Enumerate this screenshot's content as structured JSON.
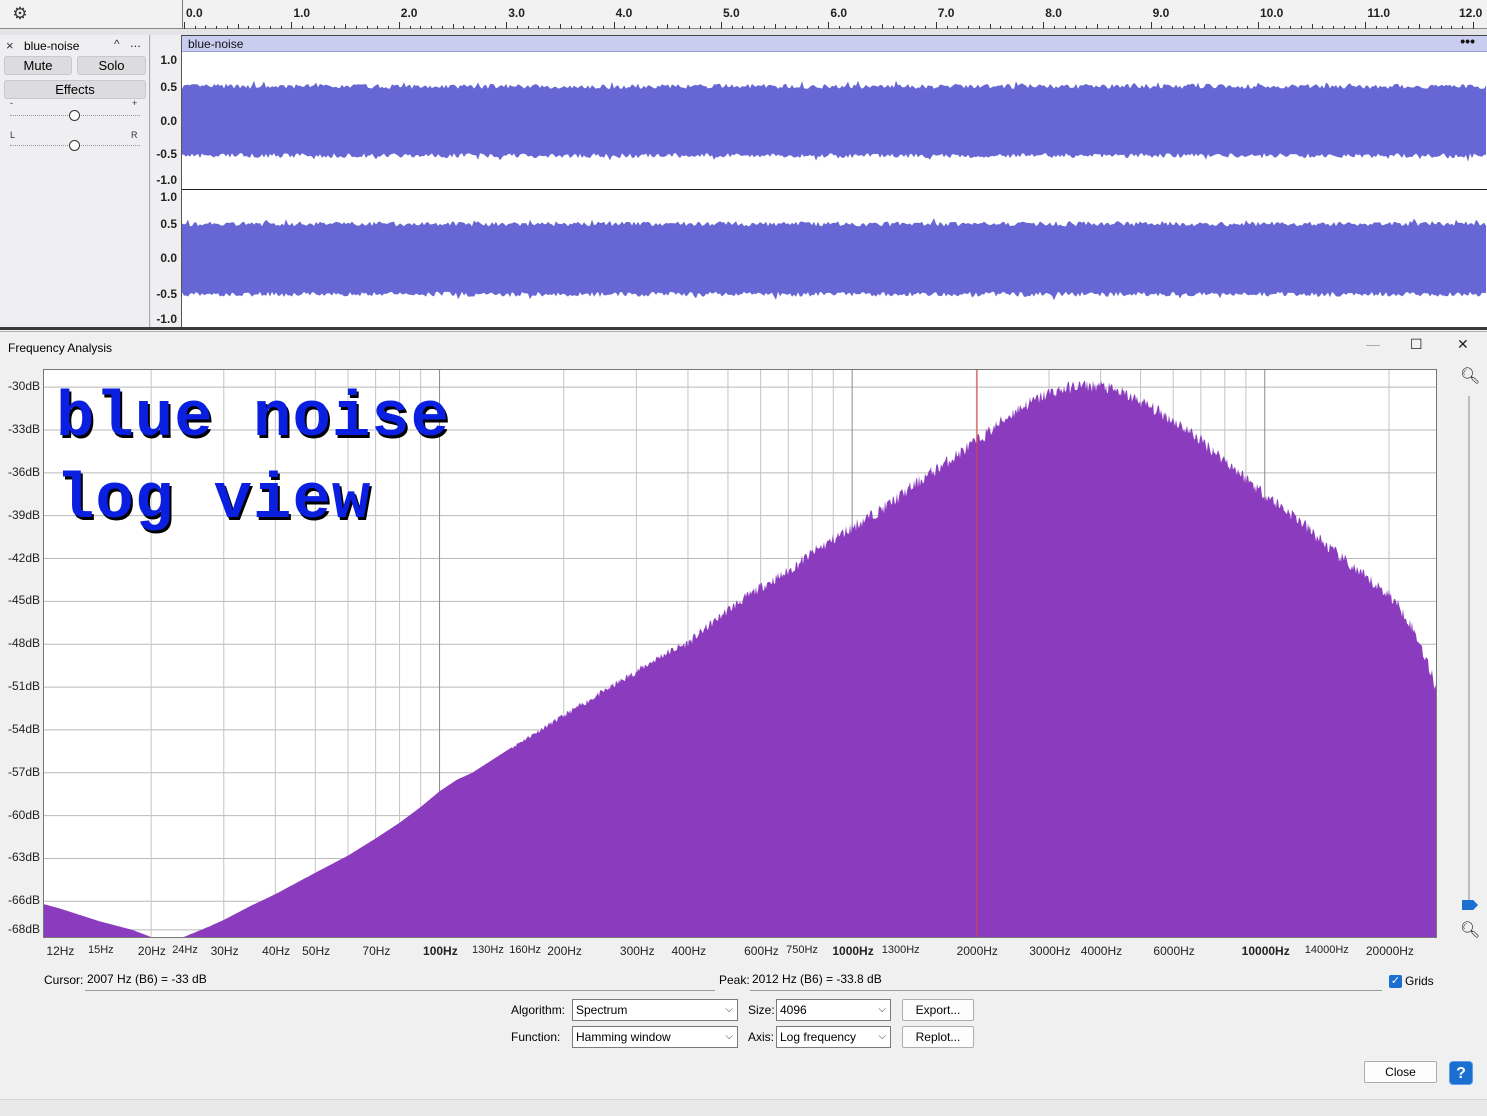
{
  "ruler": {
    "labels": [
      "0.0",
      "1.0",
      "2.0",
      "3.0",
      "4.0",
      "5.0",
      "6.0",
      "7.0",
      "8.0",
      "9.0",
      "10.0",
      "11.0",
      "12.0"
    ]
  },
  "track": {
    "name": "blue-noise",
    "mute_label": "Mute",
    "solo_label": "Solo",
    "effects_label": "Effects",
    "gain_min": "-",
    "gain_max": "+",
    "pan_left": "L",
    "pan_right": "R",
    "collapse_glyph": "^",
    "menu_glyph": "...",
    "close_glyph": "×",
    "gain_level": 0.5,
    "pan_level": 0.5
  },
  "clip": {
    "name": "blue-noise",
    "menu_glyph": "•••",
    "wave_color": "#6666d4"
  },
  "amp_scale": {
    "labels": [
      "1.0",
      "0.5",
      "0.0",
      "-0.5",
      "-1.0"
    ]
  },
  "dialog": {
    "title": "Frequency Analysis",
    "minimize": "—",
    "maximize": "☐",
    "close": "✕",
    "overlay_line1": "blue noise",
    "overlay_line2": "log view",
    "cursor_label": "Cursor:",
    "cursor_value": "2007 Hz (B6) = -33 dB",
    "peak_label": "Peak:",
    "peak_value": "2012 Hz (B6) = -33.8 dB",
    "grids_label": "Grids",
    "grids_checked": true,
    "algorithm_label": "Algorithm:",
    "algorithm_value": "Spectrum",
    "size_label": "Size:",
    "size_value": "4096",
    "export_label": "Export...",
    "function_label": "Function:",
    "function_value": "Hamming window",
    "axis_label": "Axis:",
    "axis_value": "Log frequency",
    "replot_label": "Replot...",
    "close_label": "Close",
    "help_label": "?",
    "spectrum_color": "#8a3bbe",
    "cursor_line_color": "#e04040"
  },
  "chart_data": {
    "type": "area",
    "xscale": "log",
    "xlim": [
      11,
      26000
    ],
    "ylim": [
      -68.5,
      -28.8
    ],
    "ytick_labels": [
      "-30dB",
      "-33dB",
      "-36dB",
      "-39dB",
      "-42dB",
      "-45dB",
      "-48dB",
      "-51dB",
      "-54dB",
      "-57dB",
      "-60dB",
      "-63dB",
      "-66dB",
      "-68dB"
    ],
    "yticks": [
      -30,
      -33,
      -36,
      -39,
      -42,
      -45,
      -48,
      -51,
      -54,
      -57,
      -60,
      -63,
      -66,
      -68
    ],
    "xtick_labels": [
      "12Hz",
      "15Hz",
      "20Hz",
      "24Hz",
      "30Hz",
      "40Hz",
      "50Hz",
      "70Hz",
      "100Hz",
      "130Hz",
      "160Hz",
      "200Hz",
      "300Hz",
      "400Hz",
      "600Hz",
      "750Hz",
      "1000Hz",
      "1300Hz",
      "2000Hz",
      "3000Hz",
      "4000Hz",
      "6000Hz",
      "10000Hz",
      "14000Hz",
      "20000Hz"
    ],
    "xticks": [
      12,
      15,
      20,
      24,
      30,
      40,
      50,
      70,
      100,
      130,
      160,
      200,
      300,
      400,
      600,
      750,
      1000,
      1300,
      2000,
      3000,
      4000,
      6000,
      10000,
      14000,
      20000
    ],
    "cursor_x": 2007,
    "x": [
      11,
      12,
      15,
      18,
      20,
      22,
      24,
      28,
      30,
      35,
      40,
      50,
      60,
      70,
      80,
      90,
      100,
      110,
      120,
      150,
      200,
      250,
      300,
      350,
      400,
      500,
      600,
      700,
      800,
      1000,
      1200,
      1500,
      2000,
      2500,
      3000,
      3500,
      4000,
      4500,
      5000,
      6000,
      7000,
      8000,
      10000,
      12000,
      14000,
      16000,
      18000,
      20000,
      22000,
      24000,
      26000
    ],
    "values": [
      -66.2,
      -66.5,
      -67.4,
      -68.0,
      -68.5,
      -68.5,
      -68.5,
      -67.7,
      -67.3,
      -66.3,
      -65.5,
      -64.0,
      -62.8,
      -61.6,
      -60.5,
      -59.4,
      -58.3,
      -57.5,
      -57.0,
      -55.2,
      -53.0,
      -51.3,
      -49.9,
      -48.7,
      -47.9,
      -45.6,
      -44.0,
      -42.9,
      -41.6,
      -39.8,
      -38.4,
      -36.3,
      -33.8,
      -31.6,
      -30.4,
      -29.9,
      -29.9,
      -30.4,
      -31.0,
      -32.3,
      -33.7,
      -35.1,
      -37.5,
      -39.2,
      -41.0,
      -42.4,
      -43.6,
      -44.5,
      -46.0,
      -48.2,
      -51.0
    ],
    "grid": true
  }
}
